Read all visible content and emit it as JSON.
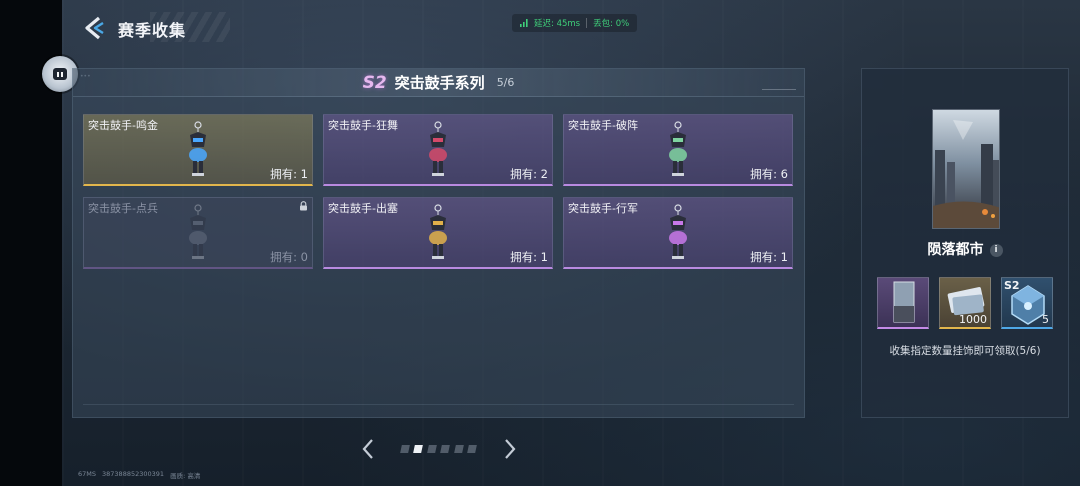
{
  "header": {
    "title": "赛季收集",
    "latency_label": "延迟:",
    "latency_value": "45ms",
    "packet_loss_label": "丢包:",
    "packet_loss_value": "0%"
  },
  "overlay_button": {
    "label": "•••"
  },
  "panel": {
    "season_badge": "S2",
    "series_title": "突击鼓手系列",
    "progress": "5/6"
  },
  "own_label": "拥有:",
  "cards": [
    {
      "name": "突击鼓手-鸣金",
      "owned": "1",
      "rarity": "gold",
      "locked": false
    },
    {
      "name": "突击鼓手-狂舞",
      "owned": "2",
      "rarity": "purple",
      "locked": false
    },
    {
      "name": "突击鼓手-破阵",
      "owned": "6",
      "rarity": "purple",
      "locked": false
    },
    {
      "name": "突击鼓手-点兵",
      "owned": "0",
      "rarity": "purple",
      "locked": true
    },
    {
      "name": "突击鼓手-出塞",
      "owned": "1",
      "rarity": "purple",
      "locked": false
    },
    {
      "name": "突击鼓手-行军",
      "owned": "1",
      "rarity": "purple",
      "locked": false
    }
  ],
  "pager": {
    "total_pages": 6,
    "current_page": 2
  },
  "footer": {
    "fps": "67MS",
    "uid": "387388852300391",
    "quality_label": "画质:",
    "quality_value": "高清"
  },
  "reward": {
    "name": "陨落都市",
    "items": [
      {
        "type": "card",
        "qty": "",
        "tag": ""
      },
      {
        "type": "currency",
        "qty": "1000",
        "tag": ""
      },
      {
        "type": "crate",
        "qty": "5",
        "tag": "S2"
      }
    ],
    "description": "收集指定数量挂饰即可领取(5/6)"
  },
  "colors": {
    "gold": "#e2b64c",
    "purple": "#b98ae0",
    "blue": "#4ea8e8",
    "status_green": "#3fcf7a",
    "season_pink": "#e6b8ef"
  }
}
